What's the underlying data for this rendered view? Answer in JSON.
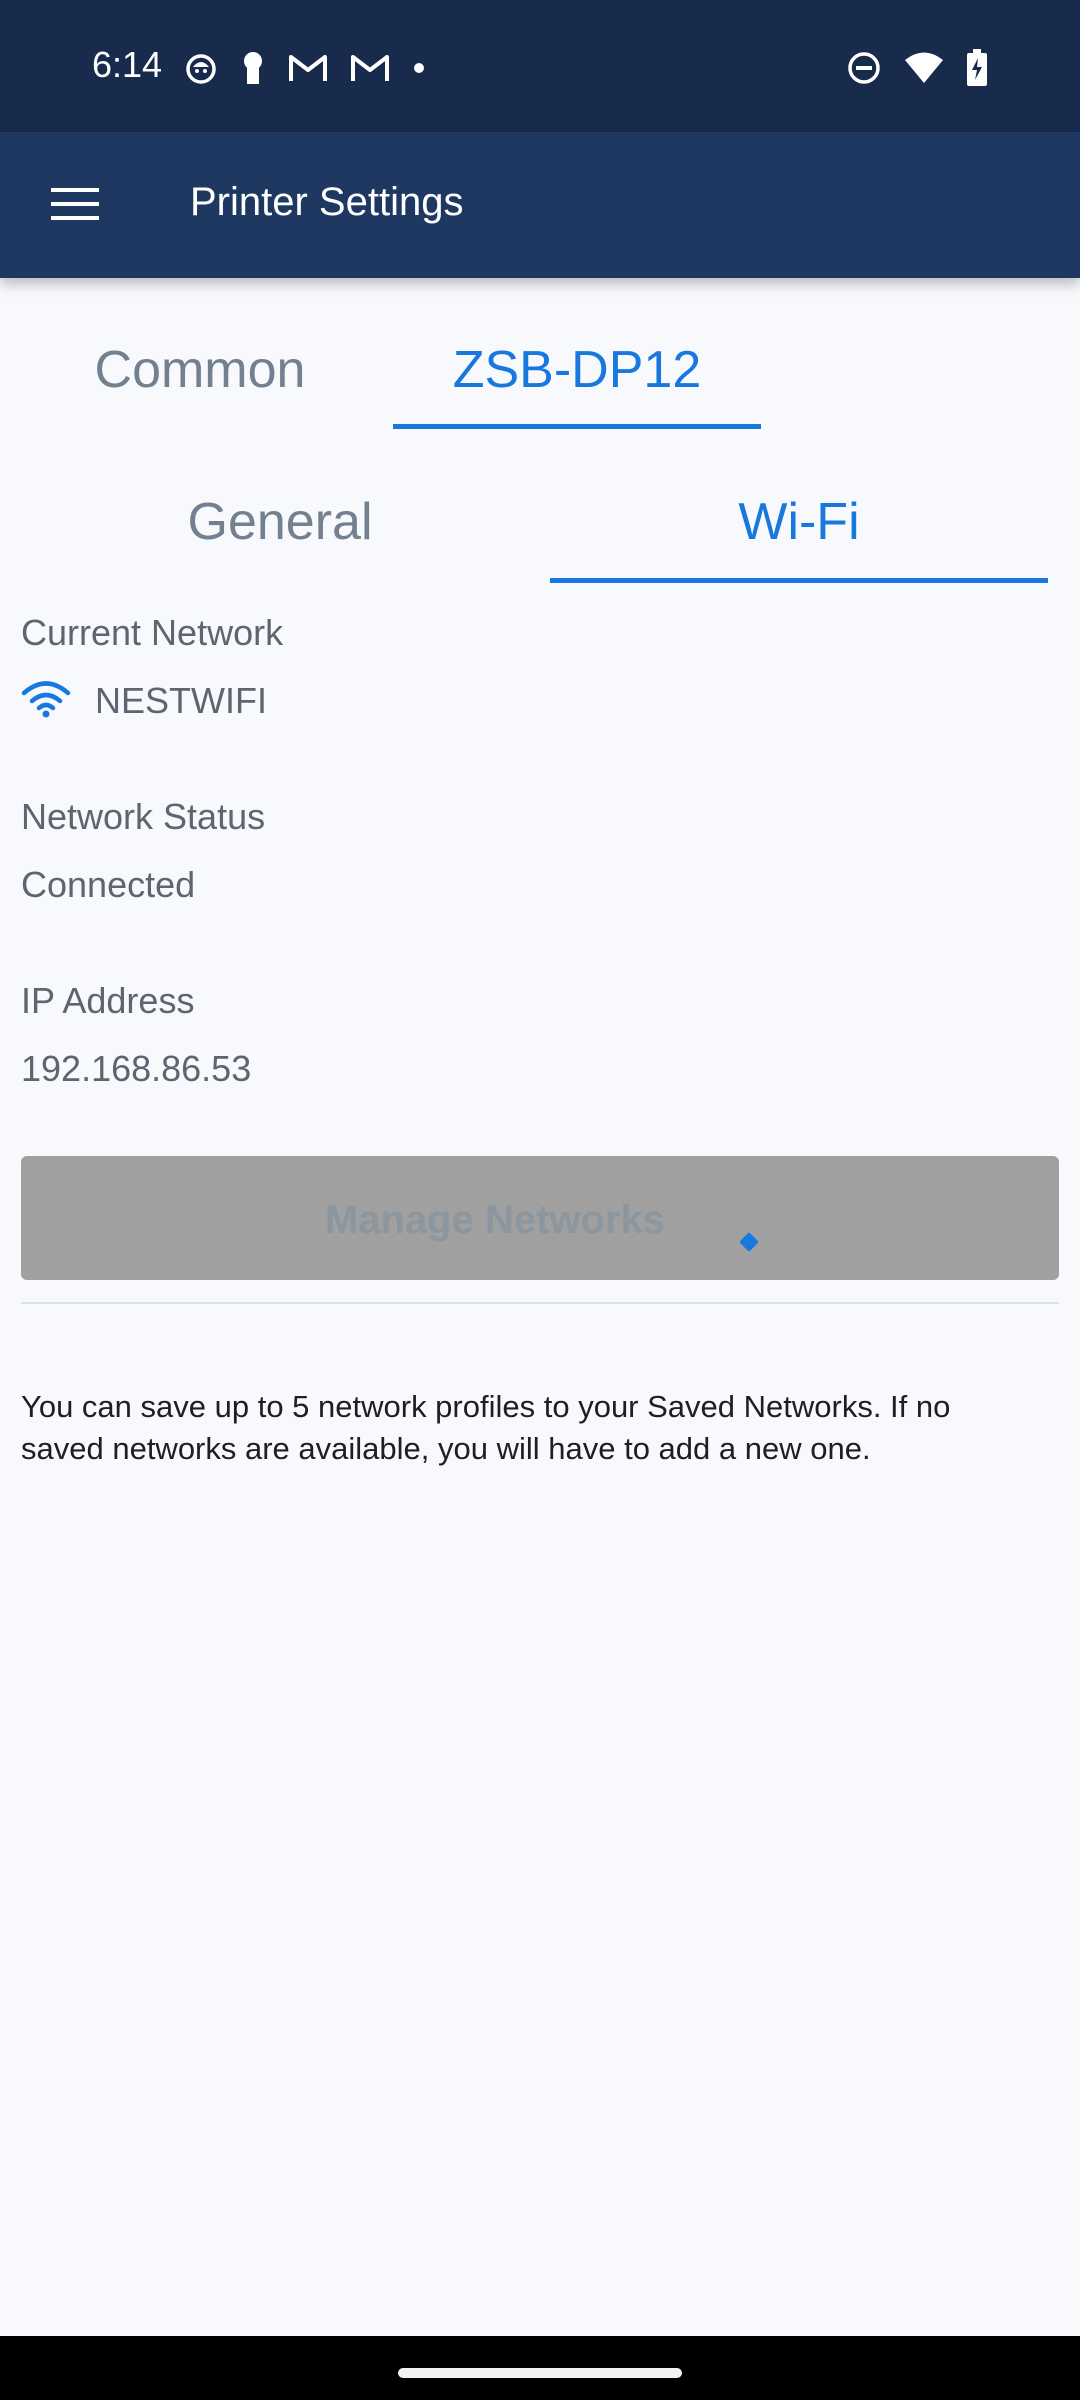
{
  "status_bar": {
    "time": "6:14",
    "left_icons": [
      "cat-notification-icon",
      "keyhole-icon",
      "gmail-icon",
      "gmail-icon",
      "dot-icon"
    ],
    "right_icons": [
      "do-not-disturb-icon",
      "wifi-signal-icon",
      "battery-charging-icon"
    ]
  },
  "app_bar": {
    "menu_icon": "hamburger-menu-icon",
    "title": "Printer Settings"
  },
  "primary_tabs": [
    {
      "label": "Common",
      "selected": false
    },
    {
      "label": "ZSB-DP12",
      "selected": true
    }
  ],
  "secondary_tabs": [
    {
      "label": "General",
      "selected": false
    },
    {
      "label": "Wi-Fi",
      "selected": true
    }
  ],
  "wifi": {
    "current_network_label": "Current Network",
    "current_network_icon": "wifi-icon",
    "current_network_name": "NESTWIFI",
    "status_label": "Network Status",
    "status_value": "Connected",
    "ip_label": "IP Address",
    "ip_value": "192.168.86.53",
    "manage_button_label": "Manage Networks",
    "info_text": "You can save up to 5 network profiles to your Saved Networks. If no saved networks are available, you will have to add a new one."
  },
  "colors": {
    "status_bar_bg": "#182b4c",
    "app_bar_bg": "#1e3862",
    "accent": "#1878de",
    "inactive_tab": "#72808f",
    "disabled_button": "#a0a0a0",
    "background": "#f8f9fd"
  }
}
